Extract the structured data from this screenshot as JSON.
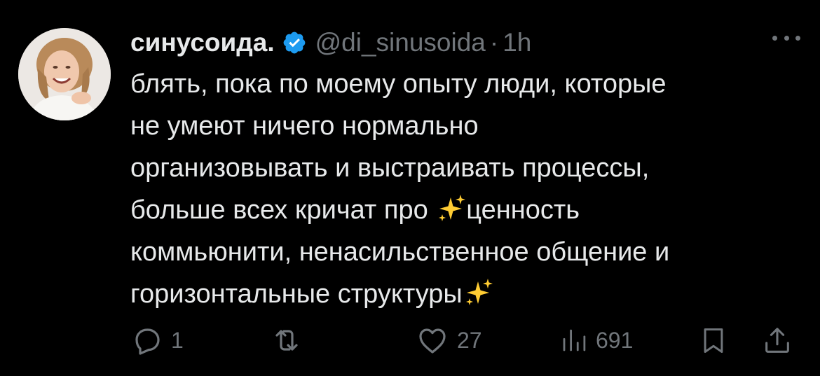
{
  "tweet": {
    "author": {
      "display_name": "синусоида.",
      "handle": "@di_sinusoida",
      "verified_icon": "verified-badge-icon",
      "avatar": "avatar"
    },
    "separator": "·",
    "time": "1h",
    "more_icon": "more-options-icon",
    "text_lines": [
      "блять, пока по моему опыту люди, которые",
      "не умеют ничего нормально",
      "организовывать и выстраивать процессы,",
      "больше всех кричат про ",
      "ценность",
      "коммьюнити, ненасильственное общение и",
      "горизонтальные структуры"
    ],
    "actions": {
      "reply": {
        "icon": "reply-icon",
        "count": "1"
      },
      "retweet": {
        "icon": "retweet-icon",
        "count": ""
      },
      "like": {
        "icon": "heart-icon",
        "count": "27"
      },
      "views": {
        "icon": "views-bar-chart-icon",
        "count": "691"
      },
      "bookmark": {
        "icon": "bookmark-icon"
      },
      "share": {
        "icon": "share-icon"
      }
    }
  },
  "colors": {
    "background": "#000000",
    "primary_text": "#e7e9ea",
    "secondary_text": "#71767b",
    "verified_blue": "#1d9bf0",
    "sparkles": "#ffcc33"
  }
}
